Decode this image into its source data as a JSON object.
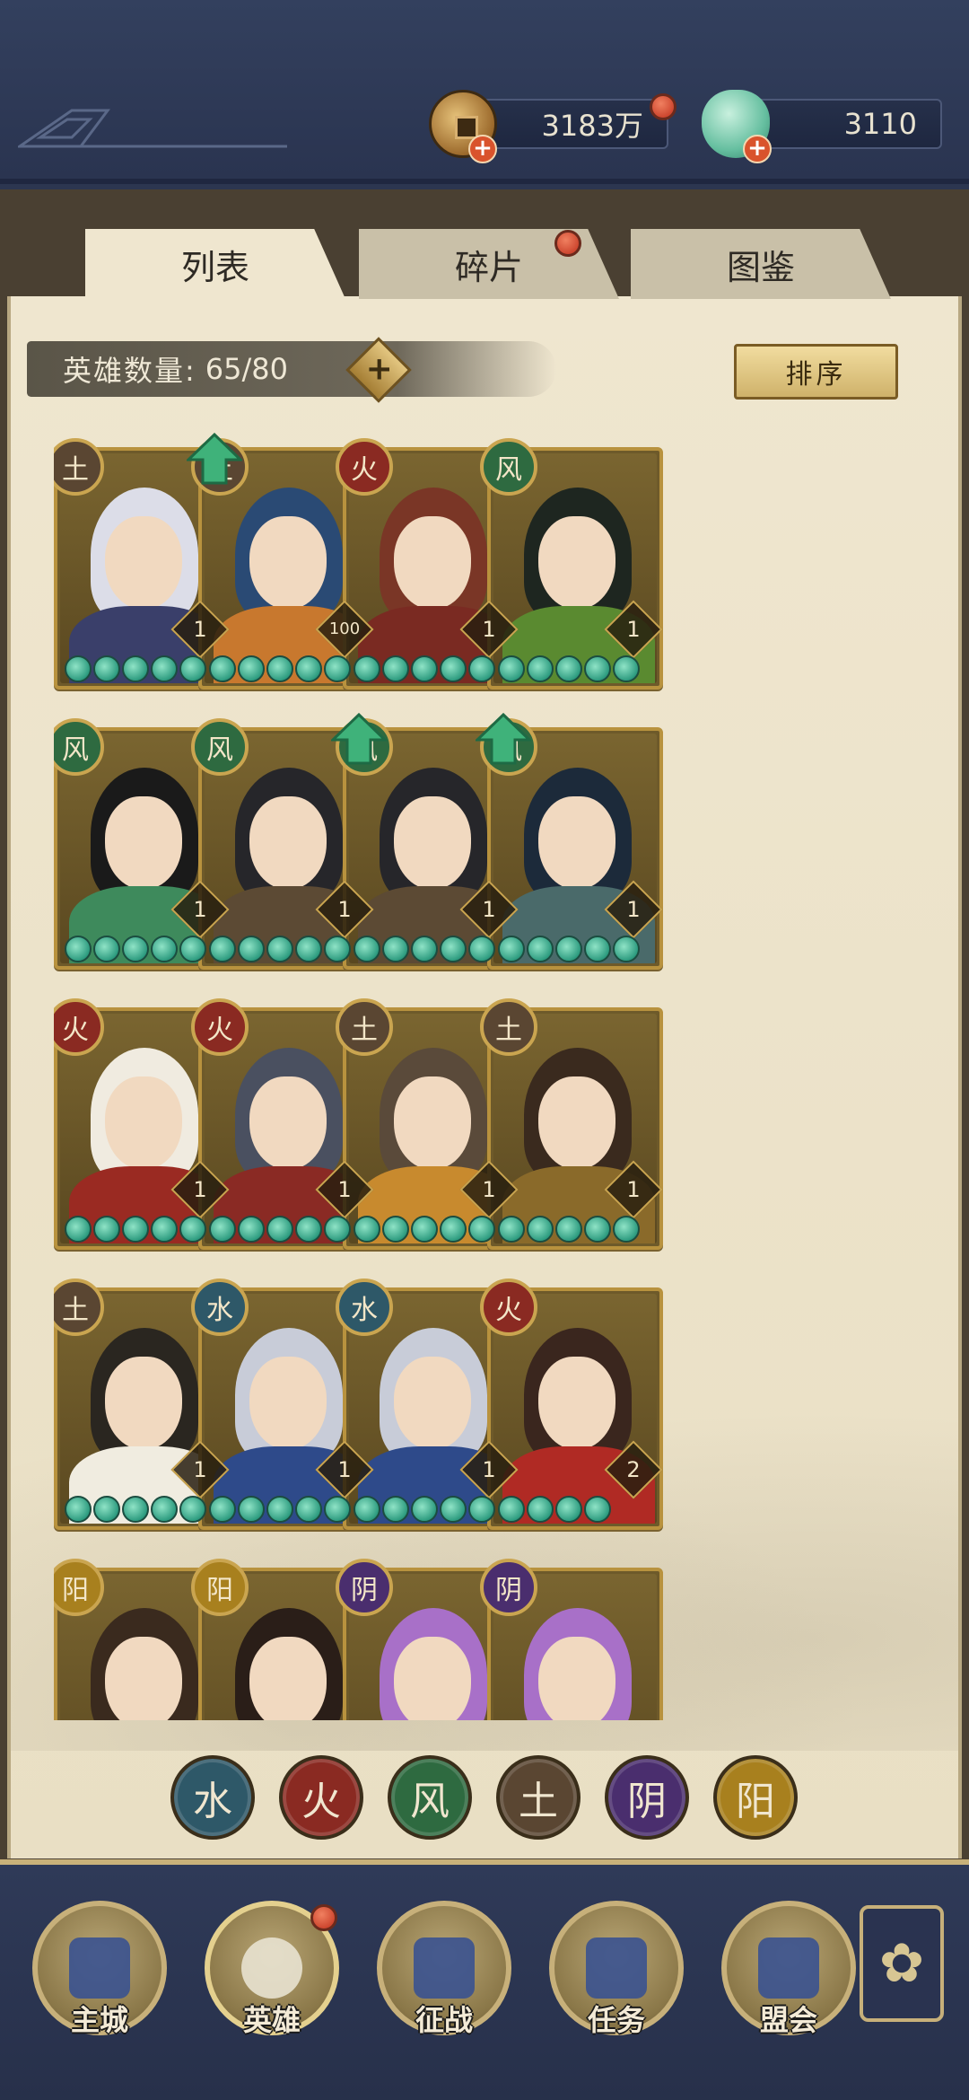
{
  "currencies": {
    "coin": {
      "value": "3183万",
      "icon": "copper-coin-icon"
    },
    "jade": {
      "value": "3110",
      "icon": "jade-icon"
    }
  },
  "tabs": [
    {
      "label": "列表",
      "active": true
    },
    {
      "label": "碎片",
      "active": false,
      "has_notification": true
    },
    {
      "label": "图鉴",
      "active": false
    }
  ],
  "hero_count": {
    "label": "英雄数量:",
    "value": "65/80"
  },
  "sort_label": "排序",
  "heroes": [
    {
      "element": "土",
      "level": "1",
      "stars": 5,
      "upgrade": true,
      "hair": "#dcdde8",
      "body": "#3a3f6a"
    },
    {
      "element": "土",
      "level": "100",
      "stars": 5,
      "upgrade": false,
      "hair": "#2a4a74",
      "body": "#c8782e"
    },
    {
      "element": "火",
      "level": "1",
      "stars": 5,
      "upgrade": false,
      "hair": "#7a3626",
      "body": "#7a2a22"
    },
    {
      "element": "风",
      "level": "1",
      "stars": 5,
      "upgrade": false,
      "hair": "#1e2620",
      "body": "#5a8a30"
    },
    {
      "element": "风",
      "level": "1",
      "stars": 5,
      "upgrade": false,
      "hair": "#1a1a1a",
      "body": "#3e8a5c"
    },
    {
      "element": "风",
      "level": "1",
      "stars": 5,
      "upgrade": true,
      "hair": "#26262a",
      "body": "#5c4a34"
    },
    {
      "element": "风",
      "level": "1",
      "stars": 5,
      "upgrade": true,
      "hair": "#26262a",
      "body": "#5c4a34"
    },
    {
      "element": "风",
      "level": "1",
      "stars": 5,
      "upgrade": false,
      "hair": "#1c2a3a",
      "body": "#4a6a6a"
    },
    {
      "element": "火",
      "level": "1",
      "stars": 5,
      "upgrade": false,
      "hair": "#f0ebe0",
      "body": "#9a2a22"
    },
    {
      "element": "火",
      "level": "1",
      "stars": 5,
      "upgrade": false,
      "hair": "#4a5060",
      "body": "#8a2a24"
    },
    {
      "element": "土",
      "level": "1",
      "stars": 5,
      "upgrade": false,
      "hair": "#5a4a3a",
      "body": "#c88a2e"
    },
    {
      "element": "土",
      "level": "1",
      "stars": 5,
      "upgrade": false,
      "hair": "#3a2a1e",
      "body": "#8a6a2a"
    },
    {
      "element": "土",
      "level": "1",
      "stars": 5,
      "upgrade": false,
      "hair": "#2a2620",
      "body": "#f0ece0"
    },
    {
      "element": "水",
      "level": "1",
      "stars": 5,
      "upgrade": false,
      "hair": "#c8ccd8",
      "body": "#2e4a8a"
    },
    {
      "element": "水",
      "level": "1",
      "stars": 5,
      "upgrade": false,
      "hair": "#c8ccd8",
      "body": "#2e4a8a"
    },
    {
      "element": "火",
      "level": "2",
      "stars": 4,
      "upgrade": false,
      "hair": "#3a261e",
      "body": "#b02a24"
    },
    {
      "element": "阳",
      "level": "",
      "stars": 0,
      "upgrade": false,
      "hair": "#3a2a1e",
      "body": "#2a2a22"
    },
    {
      "element": "阳",
      "level": "",
      "stars": 0,
      "upgrade": false,
      "hair": "#2a1e18",
      "body": "#e8e2d0"
    },
    {
      "element": "阴",
      "level": "",
      "stars": 0,
      "upgrade": false,
      "hair": "#a870c8",
      "body": "#2a2a4a"
    },
    {
      "element": "阴",
      "level": "",
      "stars": 0,
      "upgrade": false,
      "hair": "#a870c8",
      "body": "#2a2a4a"
    }
  ],
  "element_colors": {
    "水": "#2e5868",
    "火": "#8a2a22",
    "风": "#2e6a40",
    "土": "#5a4632",
    "阴": "#4a2e6e",
    "阳": "#a8801e"
  },
  "filters": [
    {
      "label": "水",
      "icon": "water-element-icon"
    },
    {
      "label": "火",
      "icon": "fire-element-icon"
    },
    {
      "label": "风",
      "icon": "wind-element-icon"
    },
    {
      "label": "土",
      "icon": "earth-element-icon"
    },
    {
      "label": "阴",
      "icon": "yin-element-icon"
    },
    {
      "label": "阳",
      "icon": "yang-element-icon"
    }
  ],
  "nav": [
    {
      "label": "主城",
      "icon": "city-icon",
      "active": false
    },
    {
      "label": "英雄",
      "icon": "hero-icon",
      "active": true
    },
    {
      "label": "征战",
      "icon": "battle-icon",
      "active": false
    },
    {
      "label": "任务",
      "icon": "quest-icon",
      "active": false
    },
    {
      "label": "盟会",
      "icon": "guild-icon",
      "active": false
    }
  ],
  "more_icon": "menu-flower-icon"
}
